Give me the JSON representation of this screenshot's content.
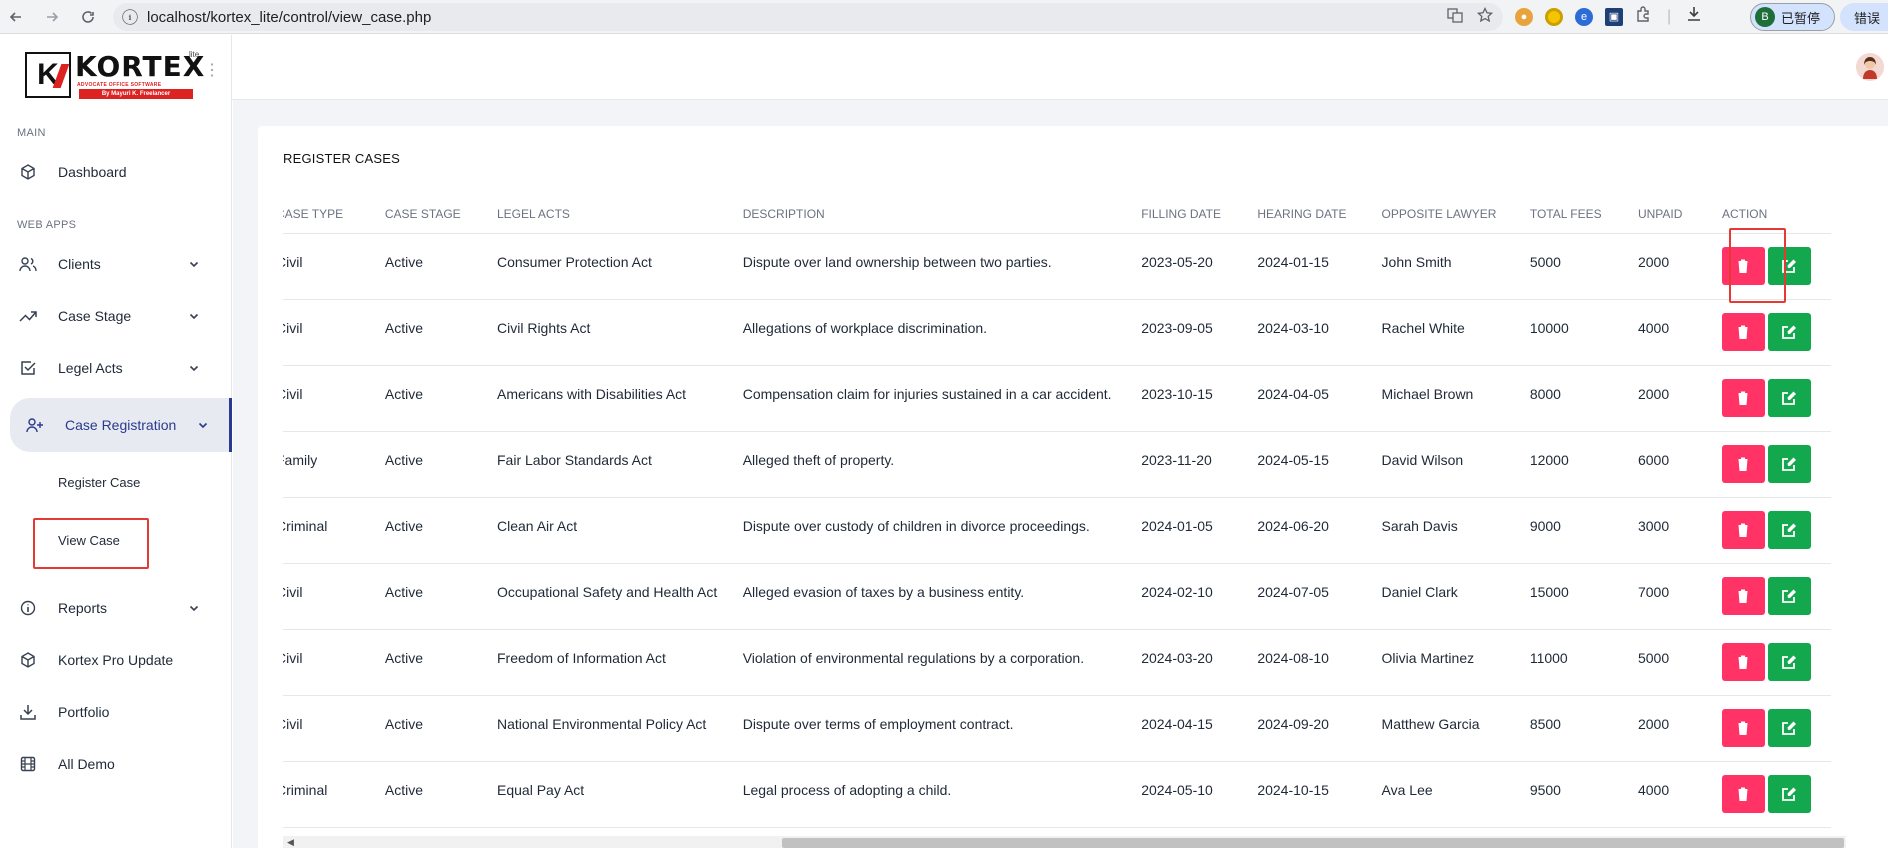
{
  "browser": {
    "url": "localhost/kortex_lite/control/view_case.php",
    "profile_initial": "B",
    "profile_label": "已暂停",
    "error_label": "错误"
  },
  "logo": {
    "word": "KORTEX",
    "lite": "lite",
    "tagline": "ADVOCATE OFFICE SOFTWARE",
    "byline": "By Mayuri K. Freelancer"
  },
  "sidebar": {
    "main_label": "MAIN",
    "webapps_label": "WEB APPS",
    "dashboard": "Dashboard",
    "clients": "Clients",
    "case_stage": "Case Stage",
    "legel_acts": "Legel Acts",
    "case_registration": "Case Registration",
    "register_case": "Register Case",
    "view_case": "View Case",
    "reports": "Reports",
    "kortex_pro_update": "Kortex Pro Update",
    "portfolio": "Portfolio",
    "all_demo": "All Demo"
  },
  "page": {
    "title": "REGISTER CASES"
  },
  "table": {
    "headers": [
      "CASE TYPE",
      "CASE STAGE",
      "LEGEL ACTS",
      "DESCRIPTION",
      "FILLING DATE",
      "HEARING DATE",
      "OPPOSITE LAWYER",
      "TOTAL FEES",
      "UNPAID",
      "ACTION"
    ],
    "rows": [
      [
        "Civil",
        "Active",
        "Consumer Protection Act",
        "Dispute over land ownership between two parties.",
        "2023-05-20",
        "2024-01-15",
        "John Smith",
        "5000",
        "2000"
      ],
      [
        "Civil",
        "Active",
        "Civil Rights Act",
        "Allegations of workplace discrimination.",
        "2023-09-05",
        "2024-03-10",
        "Rachel White",
        "10000",
        "4000"
      ],
      [
        "Civil",
        "Active",
        "Americans with Disabilities Act",
        "Compensation claim for injuries sustained in a car accident.",
        "2023-10-15",
        "2024-04-05",
        "Michael Brown",
        "8000",
        "2000"
      ],
      [
        "Family",
        "Active",
        "Fair Labor Standards Act",
        "Alleged theft of property.",
        "2023-11-20",
        "2024-05-15",
        "David Wilson",
        "12000",
        "6000"
      ],
      [
        "Criminal",
        "Active",
        "Clean Air Act",
        "Dispute over custody of children in divorce proceedings.",
        "2024-01-05",
        "2024-06-20",
        "Sarah Davis",
        "9000",
        "3000"
      ],
      [
        "Civil",
        "Active",
        "Occupational Safety and Health Act",
        "Alleged evasion of taxes by a business entity.",
        "2024-02-10",
        "2024-07-05",
        "Daniel Clark",
        "15000",
        "7000"
      ],
      [
        "Civil",
        "Active",
        "Freedom of Information Act",
        "Violation of environmental regulations by a corporation.",
        "2024-03-20",
        "2024-08-10",
        "Olivia Martinez",
        "11000",
        "5000"
      ],
      [
        "Civil",
        "Active",
        "National Environmental Policy Act",
        "Dispute over terms of employment contract.",
        "2024-04-15",
        "2024-09-20",
        "Matthew Garcia",
        "8500",
        "2000"
      ],
      [
        "Criminal",
        "Active",
        "Equal Pay Act",
        "Legal process of adopting a child.",
        "2024-05-10",
        "2024-10-15",
        "Ava Lee",
        "9500",
        "4000"
      ]
    ]
  },
  "colors": {
    "delete_button": "#ff3366",
    "edit_button": "#13a84e",
    "active_accent": "#2a3a8c",
    "highlight_box": "#e53935"
  }
}
